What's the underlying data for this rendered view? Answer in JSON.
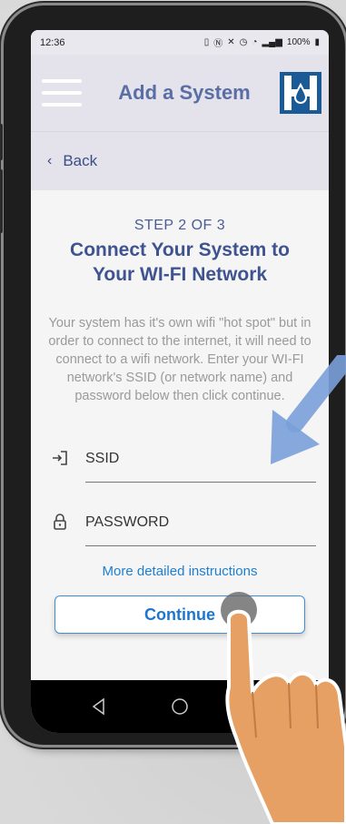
{
  "status_bar": {
    "time": "12:36",
    "battery": "100%"
  },
  "app_bar": {
    "title": "Add a System",
    "logo_letter": "H"
  },
  "nav": {
    "back_label": "Back"
  },
  "content": {
    "step_label": "STEP 2 OF 3",
    "heading_line1": "Connect Your System to",
    "heading_line2": "Your WI-FI Network",
    "description": "Your system has it's own wifi \"hot spot\" but in order to connect to the internet, it will need to connect to a wifi network. Enter your WI-FI network's SSID (or network name) and password below then click continue."
  },
  "form": {
    "ssid_placeholder": "SSID",
    "password_placeholder": "PASSWORD",
    "instructions_link": "More detailed instructions",
    "continue_label": "Continue"
  },
  "colors": {
    "accent": "#1e7fd1",
    "title": "#5a6ea6",
    "logo": "#1a5a96"
  },
  "icons": {
    "login": "login-icon",
    "lock": "lock-icon",
    "menu": "hamburger-menu-icon"
  }
}
